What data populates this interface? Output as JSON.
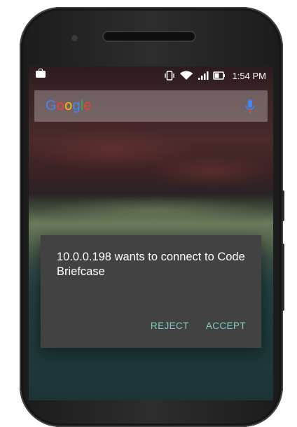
{
  "status_bar": {
    "time": "1:54 PM",
    "left_icon": "briefcase-icon",
    "right_icons": [
      "vibrate-icon",
      "wifi-icon",
      "signal-icon",
      "battery-icon"
    ]
  },
  "search_bar": {
    "logo_text": "Google",
    "logo_colors": [
      "#4285F4",
      "#EA4335",
      "#FBBC05",
      "#4285F4",
      "#34A853",
      "#EA4335"
    ],
    "mic_icon": "mic-icon"
  },
  "dialog": {
    "message": "10.0.0.198 wants to connect to Code Briefcase",
    "reject_label": "REJECT",
    "accept_label": "ACCEPT",
    "accent_color": "#80cbc4"
  }
}
